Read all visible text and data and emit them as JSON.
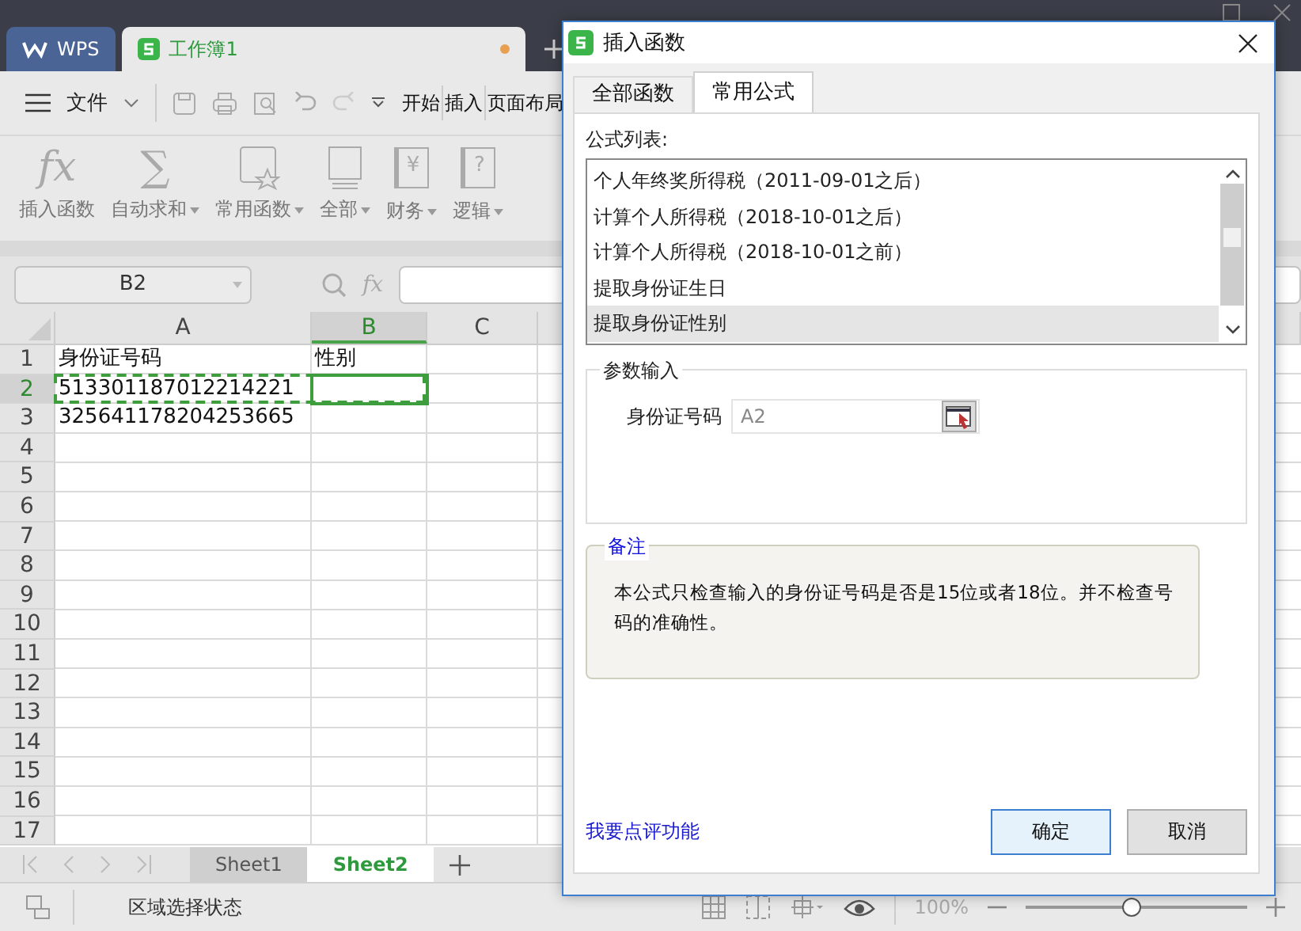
{
  "app_tabs": [
    {
      "label": "WPS",
      "kind": "home",
      "selected": false
    },
    {
      "label": "工作簿1",
      "kind": "sheet",
      "selected": true,
      "unsaved": true
    }
  ],
  "menu": {
    "file": "文件",
    "ribbon_tabs": [
      "开始",
      "插入",
      "页面布局"
    ]
  },
  "ribbon": [
    {
      "label": "插入函数",
      "kind": "fx",
      "glyph": "fx",
      "dropdown": false
    },
    {
      "label": "自动求和",
      "kind": "sum",
      "glyph": "∑",
      "dropdown": true
    },
    {
      "label": "常用函数",
      "kind": "star",
      "dropdown": true
    },
    {
      "label": "全部",
      "kind": "doc",
      "dropdown": true
    },
    {
      "label": "财务",
      "kind": "yen",
      "glyph": "¥",
      "dropdown": true
    },
    {
      "label": "逻辑",
      "kind": "help",
      "glyph": "?",
      "dropdown": true
    }
  ],
  "name_box": "B2",
  "fx_label": "fx",
  "columns": [
    {
      "label": "A",
      "selected": false
    },
    {
      "label": "B",
      "selected": true
    },
    {
      "label": "C",
      "selected": false
    }
  ],
  "rows": [
    {
      "number": "1",
      "A": "身份证号码",
      "B": "性别",
      "selected": false,
      "marquee": false
    },
    {
      "number": "2",
      "A": "513301187012214221",
      "selected": true,
      "marquee": true
    },
    {
      "number": "3",
      "A": "325641178204253665",
      "selected": false,
      "marquee": false
    },
    {
      "number": "4",
      "selected": false,
      "marquee": false
    },
    {
      "number": "5",
      "selected": false,
      "marquee": false
    },
    {
      "number": "6",
      "selected": false,
      "marquee": false
    },
    {
      "number": "7",
      "selected": false,
      "marquee": false
    },
    {
      "number": "8",
      "selected": false,
      "marquee": false
    },
    {
      "number": "9",
      "selected": false,
      "marquee": false
    },
    {
      "number": "10",
      "selected": false,
      "marquee": false
    },
    {
      "number": "11",
      "selected": false,
      "marquee": false
    },
    {
      "number": "12",
      "selected": false,
      "marquee": false
    },
    {
      "number": "13",
      "selected": false,
      "marquee": false
    },
    {
      "number": "14",
      "selected": false,
      "marquee": false
    },
    {
      "number": "15",
      "selected": false,
      "marquee": false
    },
    {
      "number": "16",
      "selected": false,
      "marquee": false
    },
    {
      "number": "17",
      "selected": false,
      "marquee": false
    }
  ],
  "sheets": [
    {
      "label": "Sheet1",
      "selected": false
    },
    {
      "label": "Sheet2",
      "selected": true
    }
  ],
  "status_bar": {
    "text": "区域选择状态",
    "zoom": "100%",
    "zoom_slider": {
      "level": 0.48
    }
  },
  "dialog": {
    "title": "插入函数",
    "tabs": [
      {
        "label": "全部函数",
        "selected": false
      },
      {
        "label": "常用公式",
        "selected": true
      }
    ],
    "list_label": "公式列表:",
    "formulas": [
      {
        "label": "个人年终奖所得税（2011-09-01之后）",
        "selected": false
      },
      {
        "label": "计算个人所得税（2018-10-01之后）",
        "selected": false
      },
      {
        "label": "计算个人所得税（2018-10-01之前）",
        "selected": false
      },
      {
        "label": "提取身份证生日",
        "selected": false
      },
      {
        "label": "提取身份证性别",
        "selected": true
      }
    ],
    "params": {
      "title": "参数输入",
      "fields": [
        {
          "label": "身份证号码",
          "value": "A2"
        }
      ]
    },
    "note": {
      "title": "备注",
      "text": "本公式只检查输入的身份证号码是否是15位或者18位。并不检查号码的准确性。"
    },
    "link": "我要点评功能",
    "buttons": [
      {
        "label": "确定",
        "kind": "primary"
      },
      {
        "label": "取消",
        "kind": "secondary"
      }
    ]
  }
}
